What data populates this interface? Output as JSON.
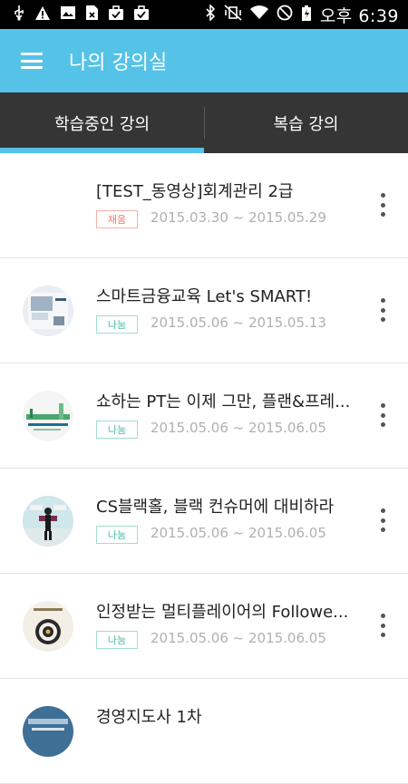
{
  "status_bar": {
    "time": "오후 6:39",
    "left_icons": [
      "usb-icon",
      "warning-icon",
      "gallery-icon",
      "sim-icon",
      "briefcase-icon",
      "briefcase-check-icon"
    ],
    "right_icons": [
      "bluetooth-icon",
      "vibrate-mute-icon",
      "wifi-icon",
      "block-icon",
      "battery-charging-icon"
    ]
  },
  "app_bar": {
    "title": "나의 강의실"
  },
  "tabs": [
    {
      "label": "학습중인 강의",
      "active": true
    },
    {
      "label": "복습 강의",
      "active": false
    }
  ],
  "courses": [
    {
      "title": "[TEST_동영상]회계관리 2급",
      "badge": "채움",
      "badge_color": "#f07b6b",
      "dates": "2015.03.30 ~ 2015.05.29",
      "thumbnail": "none"
    },
    {
      "title": "스마트금융교육 Let's SMART!",
      "badge": "나눔",
      "badge_color": "#4bbfa4",
      "dates": "2015.05.06 ~ 2015.05.13",
      "thumbnail": "smart-finance-thumbnail"
    },
    {
      "title": "쇼하는 PT는 이제 그만, 플랜&프레...",
      "badge": "나눔",
      "badge_color": "#4bbfa4",
      "dates": "2015.05.06 ~ 2015.06.05",
      "thumbnail": "presentation-thumbnail"
    },
    {
      "title": "CS블랙홀, 블랙 컨슈머에 대비하라",
      "badge": "나눔",
      "badge_color": "#4bbfa4",
      "dates": "2015.05.06 ~ 2015.06.05",
      "thumbnail": "cs-blackhole-thumbnail"
    },
    {
      "title": "인정받는 멀티플레이어의 Followe...",
      "badge": "나눔",
      "badge_color": "#4bbfa4",
      "dates": "2015.05.06 ~ 2015.06.05",
      "thumbnail": "followership-thumbnail"
    },
    {
      "title": "경영지도사 1차",
      "badge": "",
      "badge_color": "",
      "dates": "",
      "thumbnail": "consultant-thumbnail"
    }
  ],
  "colors": {
    "accent": "#55c2e8",
    "tab_bar": "#353535"
  }
}
